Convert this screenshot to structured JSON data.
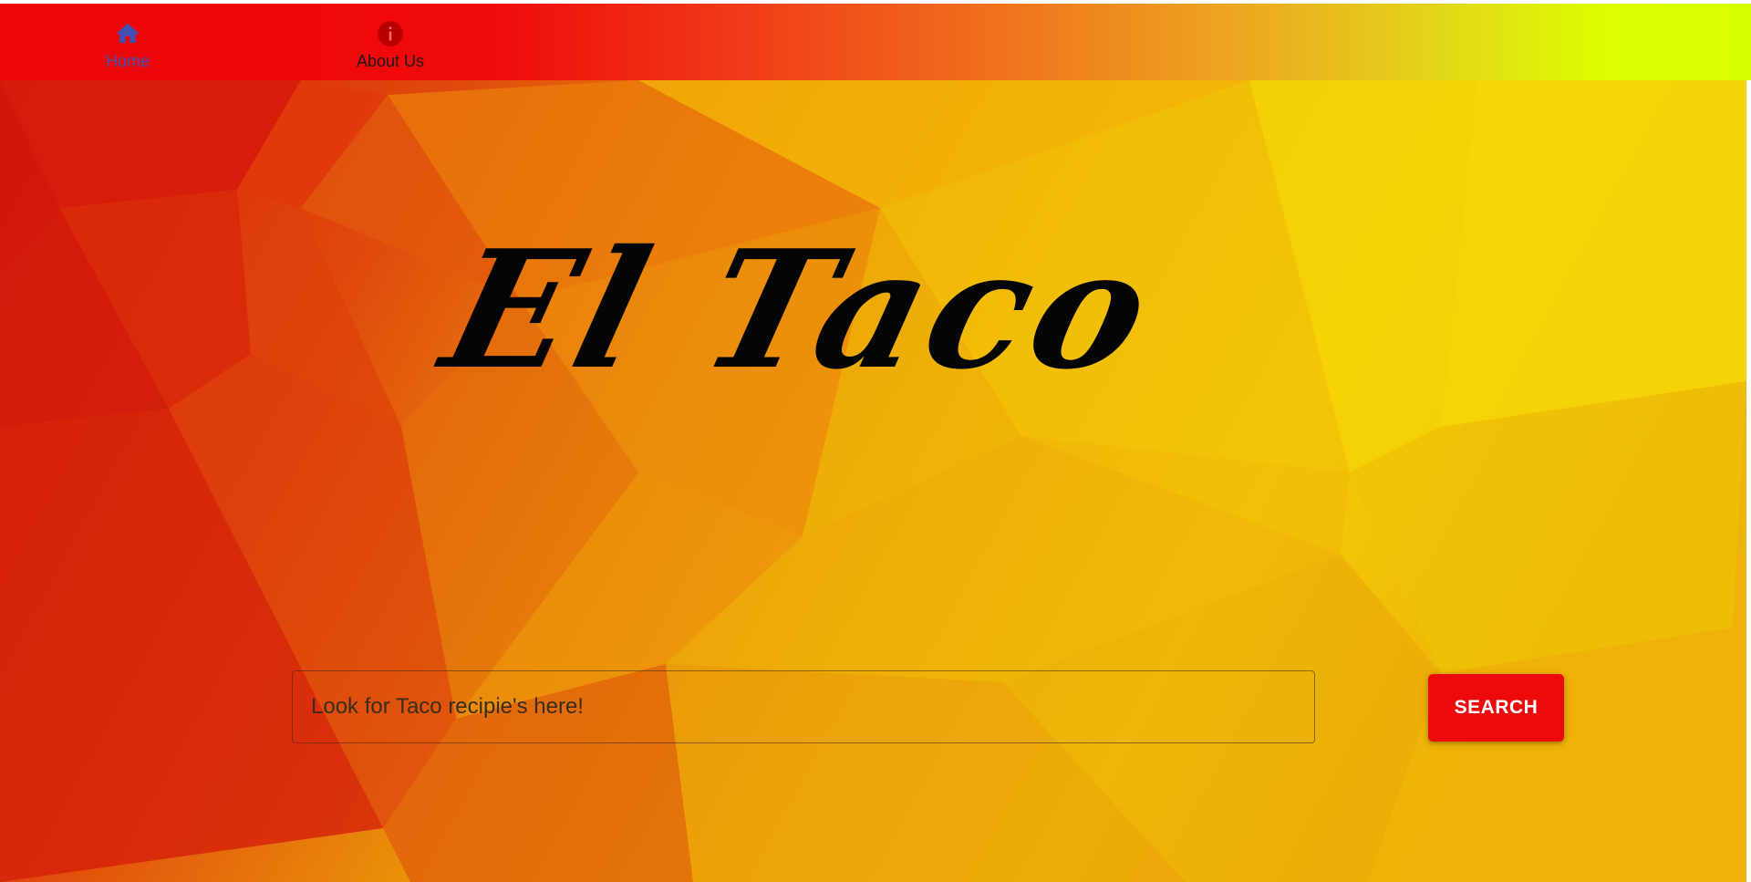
{
  "nav": {
    "items": [
      {
        "label": "Home",
        "icon": "home-icon",
        "active": true,
        "color": "#3f51b5"
      },
      {
        "label": "About Us",
        "icon": "info-icon",
        "active": false,
        "icon_color": "#b50000"
      }
    ]
  },
  "hero": {
    "logo_text": "El Taco"
  },
  "search": {
    "placeholder": "Look for Taco recipie's here!",
    "value": "",
    "button_label": "SEARCH"
  },
  "colors": {
    "accent": "#ee0a0b",
    "nav_gradient_start": "#ee0609",
    "nav_gradient_end": "#d8ff00",
    "active_nav": "#3f51b5"
  }
}
